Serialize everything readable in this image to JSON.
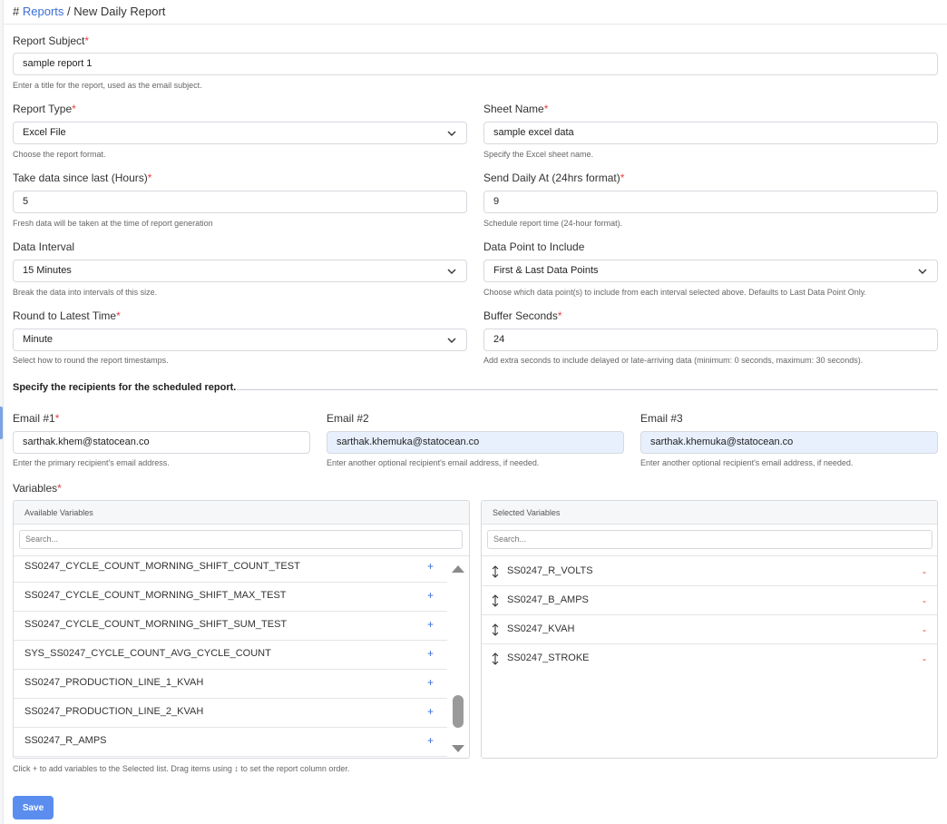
{
  "breadcrumb": {
    "hash": "#",
    "link": "Reports",
    "sep": "/",
    "current": "New Daily Report"
  },
  "form": {
    "report_subject": {
      "label": "Report Subject",
      "value": "sample report 1",
      "help": "Enter a title for the report, used as the email subject."
    },
    "report_type": {
      "label": "Report Type",
      "value": "Excel File",
      "help": "Choose the report format."
    },
    "sheet_name": {
      "label": "Sheet Name",
      "value": "sample excel data",
      "help": "Specify the Excel sheet name."
    },
    "take_data_since": {
      "label": "Take data since last (Hours)",
      "value": "5",
      "help": "Fresh data will be taken at the time of report generation"
    },
    "send_daily_at": {
      "label": "Send Daily At (24hrs format)",
      "value": "9",
      "help": "Schedule report time (24-hour format)."
    },
    "data_interval": {
      "label": "Data Interval",
      "value": "15 Minutes",
      "help": "Break the data into intervals of this size."
    },
    "data_point": {
      "label": "Data Point to Include",
      "value": "First & Last Data Points",
      "help": "Choose which data point(s) to include from each interval selected above. Defaults to Last Data Point Only."
    },
    "round_time": {
      "label": "Round to Latest Time",
      "value": "Minute",
      "help": "Select how to round the report timestamps."
    },
    "buffer_seconds": {
      "label": "Buffer Seconds",
      "value": "24",
      "help": "Add extra seconds to include delayed or late-arriving data (minimum: 0 seconds, maximum: 30 seconds)."
    },
    "required_mark": "*"
  },
  "recipients": {
    "title": "Specify the recipients for the scheduled report.",
    "email1": {
      "label": "Email #1",
      "value": "sarthak.khem@statocean.co",
      "help": "Enter the primary recipient's email address."
    },
    "email2": {
      "label": "Email #2",
      "value": "sarthak.khemuka@statocean.co",
      "help": "Enter another optional recipient's email address, if needed."
    },
    "email3": {
      "label": "Email #3",
      "value": "sarthak.khemuka@statocean.co",
      "help": "Enter another optional recipient's email address, if needed."
    }
  },
  "variables": {
    "label": "Variables",
    "available": {
      "title": "Available Variables",
      "search_placeholder": "Search...",
      "items": [
        "SS0247_CYCLE_COUNT_MORNING_SHIFT_COUNT_TEST",
        "SS0247_CYCLE_COUNT_MORNING_SHIFT_MAX_TEST",
        "SS0247_CYCLE_COUNT_MORNING_SHIFT_SUM_TEST",
        "SYS_SS0247_CYCLE_COUNT_AVG_CYCLE_COUNT",
        "SS0247_PRODUCTION_LINE_1_KVAH",
        "SS0247_PRODUCTION_LINE_2_KVAH",
        "SS0247_R_AMPS"
      ],
      "add_symbol": "+"
    },
    "selected": {
      "title": "Selected Variables",
      "search_placeholder": "Search...",
      "items": [
        "SS0247_R_VOLTS",
        "SS0247_B_AMPS",
        "SS0247_KVAH",
        "SS0247_STROKE"
      ],
      "remove_symbol": "-"
    },
    "note": "Click + to add variables to the Selected list. Drag items using ↕ to set the report column order."
  },
  "actions": {
    "save": "Save"
  },
  "colors": {
    "primary": "#5b8def",
    "link": "#3b6fd6",
    "required": "#e53e3e",
    "autofill": "#e8f0fe"
  }
}
